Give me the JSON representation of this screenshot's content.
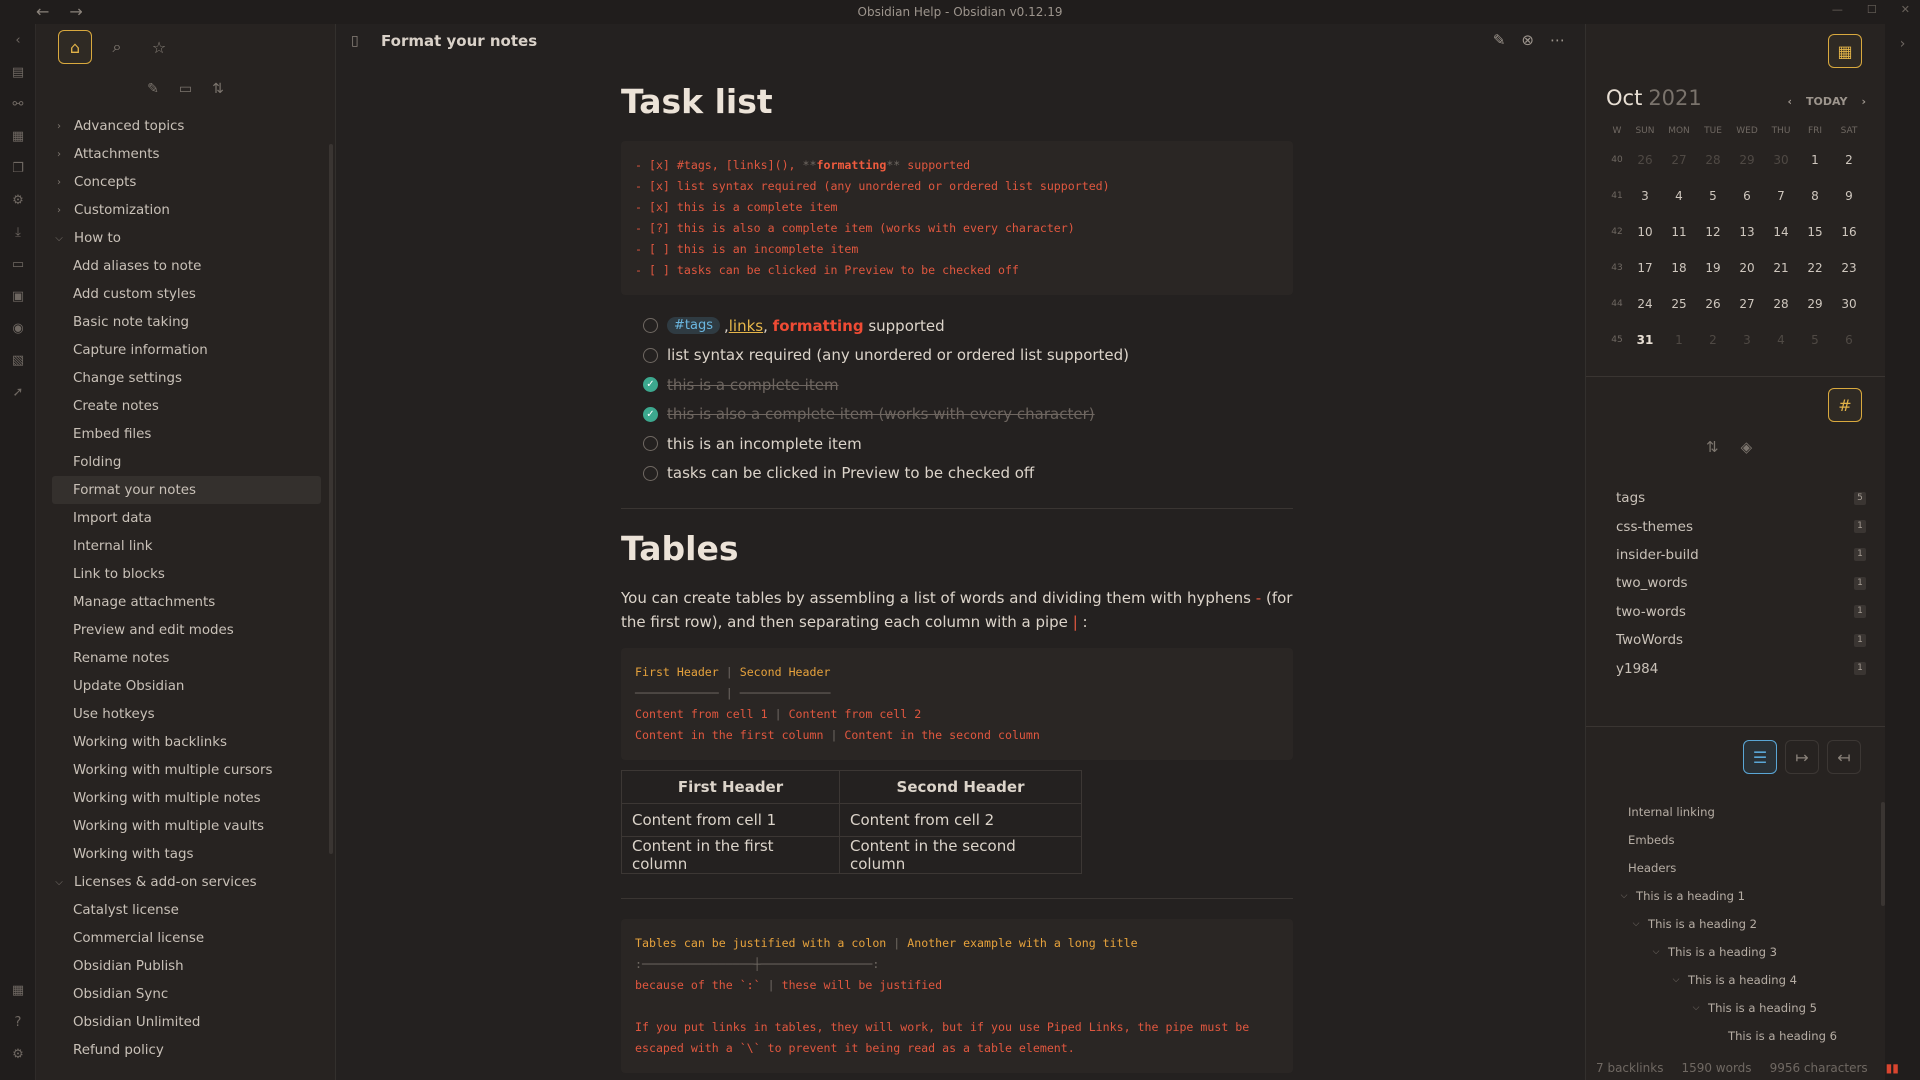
{
  "window": {
    "title": "Obsidian Help - Obsidian v0.12.19",
    "back": "←",
    "forward": "→"
  },
  "ribbon_icons": [
    "collapse-left-icon",
    "quick-switcher-icon",
    "graph-icon",
    "calendar-icon",
    "pages-icon",
    "settings-icon",
    "download-icon",
    "inbox-icon",
    "card-icon",
    "audio-icon",
    "templates-icon",
    "publish-icon"
  ],
  "left_panel": {
    "items": [
      {
        "label": "Advanced topics",
        "type": "folder",
        "open": false
      },
      {
        "label": "Attachments",
        "type": "folder",
        "open": false
      },
      {
        "label": "Concepts",
        "type": "folder",
        "open": false
      },
      {
        "label": "Customization",
        "type": "folder",
        "open": false
      },
      {
        "label": "How to",
        "type": "folder",
        "open": true
      },
      {
        "label": "Add aliases to note",
        "type": "file"
      },
      {
        "label": "Add custom styles",
        "type": "file"
      },
      {
        "label": "Basic note taking",
        "type": "file"
      },
      {
        "label": "Capture information",
        "type": "file"
      },
      {
        "label": "Change settings",
        "type": "file"
      },
      {
        "label": "Create notes",
        "type": "file"
      },
      {
        "label": "Embed files",
        "type": "file"
      },
      {
        "label": "Folding",
        "type": "file"
      },
      {
        "label": "Format your notes",
        "type": "file",
        "selected": true
      },
      {
        "label": "Import data",
        "type": "file"
      },
      {
        "label": "Internal link",
        "type": "file"
      },
      {
        "label": "Link to blocks",
        "type": "file"
      },
      {
        "label": "Manage attachments",
        "type": "file"
      },
      {
        "label": "Preview and edit modes",
        "type": "file"
      },
      {
        "label": "Rename notes",
        "type": "file"
      },
      {
        "label": "Update Obsidian",
        "type": "file"
      },
      {
        "label": "Use hotkeys",
        "type": "file"
      },
      {
        "label": "Working with backlinks",
        "type": "file"
      },
      {
        "label": "Working with multiple cursors",
        "type": "file"
      },
      {
        "label": "Working with multiple notes",
        "type": "file"
      },
      {
        "label": "Working with multiple vaults",
        "type": "file"
      },
      {
        "label": "Working with tags",
        "type": "file"
      },
      {
        "label": "Licenses & add-on services",
        "type": "folder",
        "open": true
      },
      {
        "label": "Catalyst license",
        "type": "file"
      },
      {
        "label": "Commercial license",
        "type": "file"
      },
      {
        "label": "Obsidian Publish",
        "type": "file"
      },
      {
        "label": "Obsidian Sync",
        "type": "file"
      },
      {
        "label": "Obsidian Unlimited",
        "type": "file"
      },
      {
        "label": "Refund policy",
        "type": "file"
      }
    ]
  },
  "note": {
    "title": "Format your notes",
    "task_heading": "Task list",
    "task_code": {
      "l1_pre": "- [x] #tags, [links](), ",
      "l1_stars_a": "**",
      "l1_bold": "formatting",
      "l1_stars_b": "**",
      "l1_post": " supported",
      "l2": "- [x] list syntax required (any unordered or ordered list supported)",
      "l3": "- [x] this is a complete item",
      "l4": "- [?] this is also a complete item (works with every character)",
      "l5": "- [ ] this is an incomplete item",
      "l6": "- [ ] tasks can be clicked in Preview to be checked off"
    },
    "tasks": {
      "t1_tag": "#tags",
      "t1_comma1": ",",
      "t1_link": "links",
      "t1_comma2": ",",
      "t1_fmt": "formatting",
      "t1_post": "supported",
      "t2": "list syntax required (any unordered or ordered list supported)",
      "t3": "this is a complete item",
      "t4": "this is also a complete item (works with every character)",
      "t5": "this is an incomplete item",
      "t6": "tasks can be clicked in Preview to be checked off"
    },
    "tables_heading": "Tables",
    "tables_para_a": "You can create tables by assembling a list of words and dividing them with hyphens",
    "tables_para_hyphen": "-",
    "tables_para_b": "(for the first row), and then separating each column with a pipe",
    "tables_para_pipe": "|",
    "tables_para_c": ":",
    "table_code": {
      "h1": "First Header",
      "sep": "|",
      "h2": "Second Header",
      "rule1": "────────────",
      "rule2": "─────────────",
      "r1a": "Content from cell 1",
      "r1b": "Content from cell 2",
      "r2a": "Content in the first column",
      "r2b": "Content in the second column"
    },
    "table": {
      "headers": [
        "First Header",
        "Second Header"
      ],
      "rows": [
        [
          "Content from cell 1",
          "Content from cell 2"
        ],
        [
          "Content in the first column",
          "Content in the second column"
        ]
      ]
    },
    "justify_code": {
      "h1": "Tables can be justified with a colon",
      "sep": "|",
      "h2": "Another example with a long title",
      "rule": ":────────────────┼────────────────:",
      "r1a": "because of the `:`",
      "r1b": "these will be justified",
      "p1": "If you put links in tables, they will work, but if you use Piped Links, the pipe must be",
      "p2": "escaped with a `\\` to prevent it being read as a table element."
    }
  },
  "calendar": {
    "month": "Oct",
    "year": "2021",
    "today_label": "TODAY",
    "week_header": "W",
    "days": [
      "SUN",
      "MON",
      "TUE",
      "WED",
      "THU",
      "FRI",
      "SAT"
    ],
    "weeks": [
      {
        "w": "40",
        "d": [
          [
            "26",
            1
          ],
          [
            "27",
            1
          ],
          [
            "28",
            1
          ],
          [
            "29",
            1
          ],
          [
            "30",
            1
          ],
          [
            "1",
            0
          ],
          [
            "2",
            0
          ]
        ]
      },
      {
        "w": "41",
        "d": [
          [
            "3",
            0
          ],
          [
            "4",
            0
          ],
          [
            "5",
            0
          ],
          [
            "6",
            0
          ],
          [
            "7",
            0
          ],
          [
            "8",
            0
          ],
          [
            "9",
            0
          ]
        ]
      },
      {
        "w": "42",
        "d": [
          [
            "10",
            0
          ],
          [
            "11",
            0
          ],
          [
            "12",
            0
          ],
          [
            "13",
            0
          ],
          [
            "14",
            0
          ],
          [
            "15",
            0
          ],
          [
            "16",
            0
          ]
        ]
      },
      {
        "w": "43",
        "d": [
          [
            "17",
            0
          ],
          [
            "18",
            0
          ],
          [
            "19",
            0
          ],
          [
            "20",
            0
          ],
          [
            "21",
            0
          ],
          [
            "22",
            0
          ],
          [
            "23",
            0
          ]
        ]
      },
      {
        "w": "44",
        "d": [
          [
            "24",
            0
          ],
          [
            "25",
            0
          ],
          [
            "26",
            0
          ],
          [
            "27",
            0
          ],
          [
            "28",
            0
          ],
          [
            "29",
            0
          ],
          [
            "30",
            0
          ]
        ]
      },
      {
        "w": "45",
        "d": [
          [
            "31",
            2
          ],
          [
            "1",
            1
          ],
          [
            "2",
            1
          ],
          [
            "3",
            1
          ],
          [
            "4",
            1
          ],
          [
            "5",
            1
          ],
          [
            "6",
            1
          ]
        ]
      }
    ]
  },
  "tags": [
    {
      "name": "tags",
      "count": "5"
    },
    {
      "name": "css-themes",
      "count": "1"
    },
    {
      "name": "insider-build",
      "count": "1"
    },
    {
      "name": "two_words",
      "count": "1"
    },
    {
      "name": "two-words",
      "count": "1"
    },
    {
      "name": "TwoWords",
      "count": "1"
    },
    {
      "name": "y1984",
      "count": "1"
    }
  ],
  "outline": [
    {
      "label": "Internal linking",
      "level": 0,
      "chev": false
    },
    {
      "label": "Embeds",
      "level": 0,
      "chev": false
    },
    {
      "label": "Headers",
      "level": 0,
      "chev": false
    },
    {
      "label": "This is a heading 1",
      "level": 0,
      "chev": true
    },
    {
      "label": "This is a heading 2",
      "level": 1,
      "chev": true
    },
    {
      "label": "This is a heading 3",
      "level": 2,
      "chev": true
    },
    {
      "label": "This is a heading 4",
      "level": 3,
      "chev": true
    },
    {
      "label": "This is a heading 5",
      "level": 4,
      "chev": true
    },
    {
      "label": "This is a heading 6",
      "level": 5,
      "chev": false
    }
  ],
  "status": {
    "backlinks": "7 backlinks",
    "words": "1590 words",
    "chars": "9956 characters"
  }
}
